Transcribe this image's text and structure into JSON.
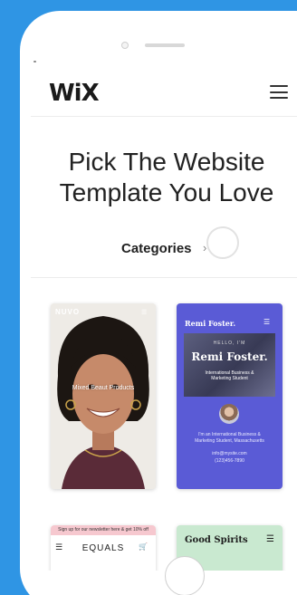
{
  "header": {
    "logo": "WiX"
  },
  "hero": {
    "line1": "Pick The Website",
    "line2": "Template You Love"
  },
  "categories": {
    "label": "Categories",
    "chevron": "›"
  },
  "templates": [
    {
      "brand": "NUVO",
      "menu": "☰",
      "tagline": "Mixed Beaut Products"
    },
    {
      "brand": "Remi Foster.",
      "menu": "☰",
      "hello": "HELLO, I'M",
      "name": "Remi Foster.",
      "title": "International Business & Marketing Student",
      "bio": "I'm an International Business & Marketing Student, Massachusetts",
      "email": "info@mysite.com",
      "phone": "(123)456-7890"
    },
    {
      "banner": "Sign up for our newsletter here & get 10% off",
      "menu": "☰",
      "brand": "EQUALS",
      "cart": "🛒"
    },
    {
      "brand": "Good Spirits",
      "menu": "☰"
    }
  ],
  "colors": {
    "background": "#2f95e4",
    "remi_card": "#5a5bd6",
    "equals_banner": "#f6c8cf",
    "spirits_card": "#c9e9d0"
  }
}
